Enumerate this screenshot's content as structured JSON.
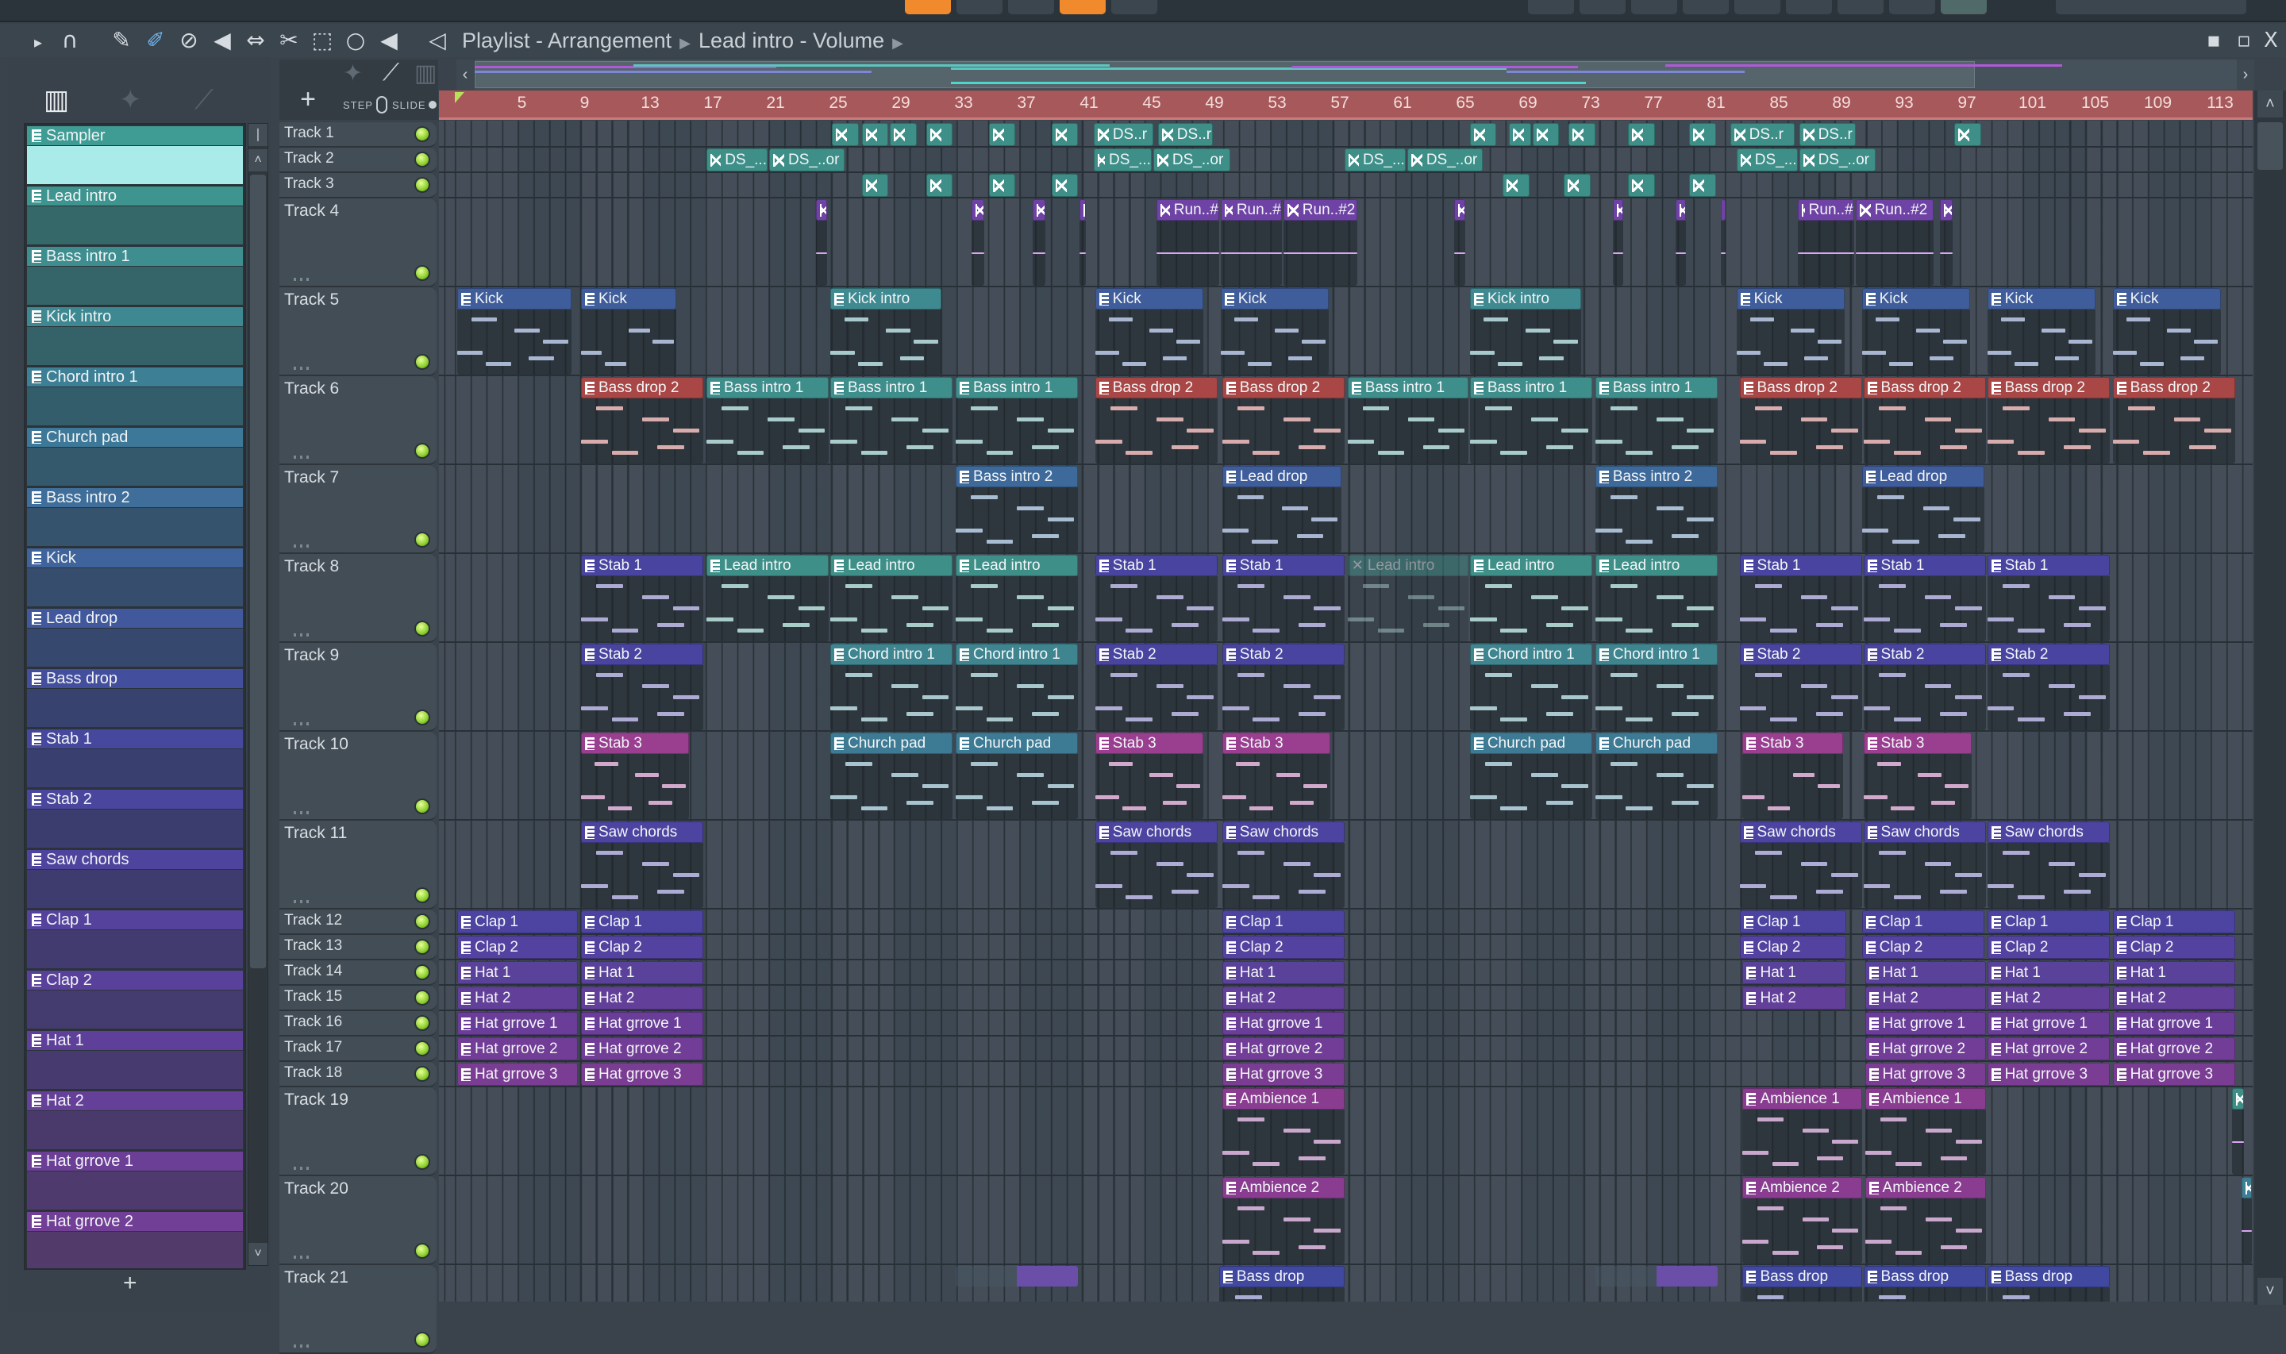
{
  "window": {
    "title": "Playlist - Arrangement",
    "subtitle": "Lead intro - Volume",
    "minimize": "▪",
    "maximize": "▫",
    "close": "X"
  },
  "toolbar_icons": [
    "play-arrow",
    "magnet-snap",
    "draw-pencil",
    "paint-brush",
    "delete",
    "mute",
    "slip",
    "slice",
    "select",
    "zoom",
    "playback",
    "speaker"
  ],
  "header": {
    "add": "+",
    "step": "STEP",
    "slide": "SLIDE"
  },
  "ruler": {
    "bars": [
      5,
      9,
      13,
      17,
      21,
      25,
      29,
      33,
      37,
      41,
      45,
      49,
      53,
      57,
      61,
      65,
      69,
      73,
      77,
      81,
      85,
      89,
      93,
      97,
      101,
      105,
      109,
      113
    ]
  },
  "picker": {
    "selected": "Sampler",
    "add": "+",
    "items": [
      {
        "label": "Sampler",
        "color": "#3f9c94"
      },
      {
        "label": "Lead intro",
        "color": "#3e948f"
      },
      {
        "label": "Bass intro 1",
        "color": "#3e8e90"
      },
      {
        "label": "Kick intro",
        "color": "#3e8892"
      },
      {
        "label": "Chord intro 1",
        "color": "#3d8095"
      },
      {
        "label": "Church pad",
        "color": "#3d7898"
      },
      {
        "label": "Bass intro 2",
        "color": "#3e6e99"
      },
      {
        "label": "Kick",
        "color": "#3f639b"
      },
      {
        "label": "Lead drop",
        "color": "#41599c"
      },
      {
        "label": "Bass drop",
        "color": "#434e9d"
      },
      {
        "label": "Stab 1",
        "color": "#46489d"
      },
      {
        "label": "Stab 2",
        "color": "#4a469d"
      },
      {
        "label": "Saw chords",
        "color": "#4e449d"
      },
      {
        "label": "Clap 1",
        "color": "#54429c"
      },
      {
        "label": "Clap 2",
        "color": "#59419b"
      },
      {
        "label": "Hat 1",
        "color": "#5e409a"
      },
      {
        "label": "Hat 2",
        "color": "#654098"
      },
      {
        "label": "Hat grrove 1",
        "color": "#6c3f97"
      },
      {
        "label": "Hat grrove 2",
        "color": "#723f96"
      }
    ]
  },
  "tracks": [
    "Track 1",
    "Track 2",
    "Track 3",
    "Track 4",
    "Track 5",
    "Track 6",
    "Track 7",
    "Track 8",
    "Track 9",
    "Track 10",
    "Track 11",
    "Track 12",
    "Track 13",
    "Track 14",
    "Track 15",
    "Track 16",
    "Track 17",
    "Track 18",
    "Track 19",
    "Track 20",
    "Track 21"
  ],
  "clips": [
    [
      1,
      25,
      1.8,
      "",
      "#3d8f88",
      "audio"
    ],
    [
      1,
      26.9,
      1.8,
      "",
      "#3d8f88",
      "audio"
    ],
    [
      1,
      28.7,
      1.8,
      "",
      "#3d8f88",
      "audio"
    ],
    [
      1,
      31,
      1.8,
      "",
      "#3d8f88",
      "audio"
    ],
    [
      1,
      35,
      1.8,
      "",
      "#3d8f88",
      "audio"
    ],
    [
      1,
      39,
      1.8,
      "",
      "#3d8f88",
      "audio"
    ],
    [
      1,
      41.7,
      3.9,
      "DS..r",
      "#3d8f88",
      "audio"
    ],
    [
      1,
      45.8,
      3.6,
      "DS..r",
      "#3d8f88",
      "audio"
    ],
    [
      1,
      65.7,
      1.8,
      "",
      "#3d8f88",
      "audio"
    ],
    [
      1,
      68.2,
      1.5,
      "",
      "#3d8f88",
      "audio"
    ],
    [
      1,
      69.7,
      1.8,
      "",
      "#3d8f88",
      "audio"
    ],
    [
      1,
      72,
      1.8,
      "",
      "#3d8f88",
      "audio"
    ],
    [
      1,
      75.8,
      1.8,
      "",
      "#3d8f88",
      "audio"
    ],
    [
      1,
      79.7,
      1.8,
      "",
      "#3d8f88",
      "audio"
    ],
    [
      1,
      82.3,
      4.2,
      "DS..r",
      "#3d8f88",
      "audio"
    ],
    [
      1,
      86.7,
      3.7,
      "DS..r",
      "#3d8f88",
      "audio"
    ],
    [
      1,
      96.6,
      1.8,
      "",
      "#3d8f88",
      "audio"
    ],
    [
      2,
      17,
      4,
      "DS_...",
      "#3d8f88",
      "audio"
    ],
    [
      2,
      21,
      4.9,
      "DS_..or",
      "#3d8f88",
      "audio"
    ],
    [
      2,
      41.7,
      3.8,
      "DS_...",
      "#3d8f88",
      "audio"
    ],
    [
      2,
      45.5,
      5,
      "DS_..or",
      "#3d8f88",
      "audio"
    ],
    [
      2,
      57.7,
      4,
      "DS_...",
      "#3d8f88",
      "audio"
    ],
    [
      2,
      61.7,
      4.9,
      "DS_..or",
      "#3d8f88",
      "audio"
    ],
    [
      2,
      82.7,
      4,
      "DS_...",
      "#3d8f88",
      "audio"
    ],
    [
      2,
      86.7,
      5,
      "DS_..or",
      "#3d8f88",
      "audio"
    ],
    [
      3,
      26.9,
      1.8,
      "",
      "#3d8f88",
      "audio"
    ],
    [
      3,
      31,
      1.8,
      "",
      "#3d8f88",
      "audio"
    ],
    [
      3,
      35,
      1.8,
      "",
      "#3d8f88",
      "audio"
    ],
    [
      3,
      39,
      1.8,
      "",
      "#3d8f88",
      "audio"
    ],
    [
      3,
      67.8,
      1.8,
      "",
      "#3d8f88",
      "audio"
    ],
    [
      3,
      71.7,
      1.8,
      "",
      "#3d8f88",
      "audio"
    ],
    [
      3,
      75.8,
      1.8,
      "",
      "#3d8f88",
      "audio"
    ],
    [
      3,
      79.7,
      1.8,
      "",
      "#3d8f88",
      "audio"
    ],
    [
      4,
      24,
      0.8,
      "",
      "#6f43a6",
      "audio"
    ],
    [
      4,
      33.9,
      0.9,
      "",
      "#6f43a6",
      "audio"
    ],
    [
      4,
      37.8,
      0.9,
      "",
      "#6f43a6",
      "audio"
    ],
    [
      4,
      40.8,
      0.5,
      "",
      "#6f43a6",
      "audio"
    ],
    [
      4,
      45.7,
      4.1,
      "Run..#",
      "#6f43a6",
      "audio"
    ],
    [
      4,
      49.8,
      4,
      "Run..#",
      "#6f43a6",
      "audio"
    ],
    [
      4,
      53.8,
      4.8,
      "Run..#2",
      "#6f43a6",
      "audio"
    ],
    [
      4,
      64.7,
      0.8,
      "",
      "#6f43a6",
      "audio"
    ],
    [
      4,
      74.8,
      0.8,
      "",
      "#6f43a6",
      "audio"
    ],
    [
      4,
      78.8,
      0.8,
      "",
      "#6f43a6",
      "audio"
    ],
    [
      4,
      81.7,
      0.4,
      "",
      "#6f43a6",
      "audio"
    ],
    [
      4,
      86.6,
      3.7,
      "Run..#",
      "#6f43a6",
      "audio"
    ],
    [
      4,
      90.3,
      5.1,
      "Run..#2",
      "#6f43a6",
      "audio"
    ],
    [
      4,
      95.7,
      0.9,
      "",
      "#6f43a6",
      "audio"
    ],
    [
      5,
      1.1,
      7.4,
      "Kick",
      "#3f5d9a"
    ],
    [
      5,
      9,
      6.2,
      "Kick",
      "#3f5d9a"
    ],
    [
      5,
      24.9,
      7.2,
      "Kick intro",
      "#3e8a90"
    ],
    [
      5,
      41.8,
      7,
      "Kick",
      "#3f5d9a"
    ],
    [
      5,
      49.8,
      7,
      "Kick",
      "#3f5d9a"
    ],
    [
      5,
      65.7,
      7.2,
      "Kick intro",
      "#3e8a90"
    ],
    [
      5,
      82.7,
      7,
      "Kick",
      "#3f5d9a"
    ],
    [
      5,
      90.7,
      7,
      "Kick",
      "#3f5d9a"
    ],
    [
      5,
      98.7,
      7,
      "Kick",
      "#3f5d9a"
    ],
    [
      5,
      106.7,
      7,
      "Kick",
      "#3f5d9a"
    ],
    [
      6,
      9,
      7.9,
      "Bass drop 2",
      "#a94646"
    ],
    [
      6,
      17,
      7.9,
      "Bass intro 1",
      "#3e8e8c"
    ],
    [
      6,
      24.9,
      7.9,
      "Bass intro 1",
      "#3e8e8c"
    ],
    [
      6,
      32.9,
      7.9,
      "Bass intro 1",
      "#3e8e8c"
    ],
    [
      6,
      41.8,
      7.9,
      "Bass drop 2",
      "#a94646"
    ],
    [
      6,
      49.9,
      7.9,
      "Bass drop 2",
      "#a94646"
    ],
    [
      6,
      57.9,
      7.8,
      "Bass intro 1",
      "#3e8e8c"
    ],
    [
      6,
      65.7,
      7.9,
      "Bass intro 1",
      "#3e8e8c"
    ],
    [
      6,
      73.7,
      7.9,
      "Bass intro 1",
      "#3e8e8c"
    ],
    [
      6,
      82.9,
      7.9,
      "Bass drop 2",
      "#a94646"
    ],
    [
      6,
      90.8,
      7.9,
      "Bass drop 2",
      "#a94646"
    ],
    [
      6,
      98.7,
      7.9,
      "Bass drop 2",
      "#a94646"
    ],
    [
      6,
      106.7,
      7.9,
      "Bass drop 2",
      "#a94646"
    ],
    [
      7,
      32.9,
      7.9,
      "Bass intro 2",
      "#3d6a9a"
    ],
    [
      7,
      49.9,
      7.7,
      "Lead drop",
      "#3f5c9b"
    ],
    [
      7,
      73.7,
      7.9,
      "Bass intro 2",
      "#3d6a9a"
    ],
    [
      7,
      90.7,
      7.9,
      "Lead drop",
      "#3f5c9b"
    ],
    [
      8,
      9,
      7.9,
      "Stab 1",
      "#4844a0"
    ],
    [
      8,
      17,
      7.9,
      "Lead intro",
      "#3d8f88"
    ],
    [
      8,
      24.9,
      7.9,
      "Lead intro",
      "#3d8f88"
    ],
    [
      8,
      32.9,
      7.9,
      "Lead intro",
      "#3d8f88"
    ],
    [
      8,
      41.8,
      7.9,
      "Stab 1",
      "#4844a0"
    ],
    [
      8,
      49.9,
      7.9,
      "Stab 1",
      "#4844a0"
    ],
    [
      8,
      57.9,
      7.8,
      "Lead intro",
      "#3d8f88",
      "muted"
    ],
    [
      8,
      65.7,
      7.9,
      "Lead intro",
      "#3d8f88"
    ],
    [
      8,
      73.7,
      7.9,
      "Lead intro",
      "#3d8f88"
    ],
    [
      8,
      82.9,
      7.9,
      "Stab 1",
      "#4844a0"
    ],
    [
      8,
      90.8,
      7.9,
      "Stab 1",
      "#4844a0"
    ],
    [
      8,
      98.7,
      7.9,
      "Stab 1",
      "#4844a0"
    ],
    [
      9,
      9,
      7.9,
      "Stab 2",
      "#4944a0"
    ],
    [
      9,
      24.9,
      7.9,
      "Chord intro 1",
      "#3e8590"
    ],
    [
      9,
      32.9,
      7.9,
      "Chord intro 1",
      "#3e8590"
    ],
    [
      9,
      41.8,
      7.9,
      "Stab 2",
      "#4944a0"
    ],
    [
      9,
      49.9,
      7.9,
      "Stab 2",
      "#4944a0"
    ],
    [
      9,
      65.7,
      7.9,
      "Chord intro 1",
      "#3e8590"
    ],
    [
      9,
      73.7,
      7.9,
      "Chord intro 1",
      "#3e8590"
    ],
    [
      9,
      82.9,
      7.9,
      "Stab 2",
      "#4944a0"
    ],
    [
      9,
      90.8,
      7.9,
      "Stab 2",
      "#4944a0"
    ],
    [
      9,
      98.7,
      7.9,
      "Stab 2",
      "#4944a0"
    ],
    [
      10,
      9,
      7,
      "Stab 3",
      "#9a3f90"
    ],
    [
      10,
      24.9,
      7.9,
      "Church pad",
      "#3d7b95"
    ],
    [
      10,
      32.9,
      7.9,
      "Church pad",
      "#3d7b95"
    ],
    [
      10,
      41.8,
      7,
      "Stab 3",
      "#9a3f90"
    ],
    [
      10,
      49.9,
      7,
      "Stab 3",
      "#9a3f90"
    ],
    [
      10,
      65.7,
      7.9,
      "Church pad",
      "#3d7b95"
    ],
    [
      10,
      73.7,
      7.9,
      "Church pad",
      "#3d7b95"
    ],
    [
      10,
      83.1,
      6.5,
      "Stab 3",
      "#9a3f90"
    ],
    [
      10,
      90.8,
      7,
      "Stab 3",
      "#9a3f90"
    ],
    [
      11,
      9,
      7.9,
      "Saw chords",
      "#4c44a0"
    ],
    [
      11,
      41.8,
      7.9,
      "Saw chords",
      "#4c44a0"
    ],
    [
      11,
      49.9,
      7.9,
      "Saw chords",
      "#4c44a0"
    ],
    [
      11,
      82.9,
      7.9,
      "Saw chords",
      "#4c44a0"
    ],
    [
      11,
      90.8,
      7.9,
      "Saw chords",
      "#4c44a0"
    ],
    [
      11,
      98.7,
      7.9,
      "Saw chords",
      "#4c44a0"
    ],
    [
      12,
      1.1,
      7.8,
      "Clap 1",
      "#4c44a0"
    ],
    [
      12,
      9,
      7.9,
      "Clap 1",
      "#4c44a0"
    ],
    [
      12,
      49.9,
      7.9,
      "Clap 1",
      "#4c44a0"
    ],
    [
      12,
      82.9,
      6.9,
      "Clap 1",
      "#4c44a0"
    ],
    [
      12,
      90.7,
      7.9,
      "Clap 1",
      "#4c44a0"
    ],
    [
      12,
      98.7,
      7.9,
      "Clap 1",
      "#4c44a0"
    ],
    [
      12,
      106.7,
      7.9,
      "Clap 1",
      "#4c44a0"
    ],
    [
      13,
      1.1,
      7.8,
      "Clap 2",
      "#5442a0"
    ],
    [
      13,
      9,
      7.9,
      "Clap 2",
      "#5442a0"
    ],
    [
      13,
      49.9,
      7.9,
      "Clap 2",
      "#5442a0"
    ],
    [
      13,
      82.9,
      6.9,
      "Clap 2",
      "#5442a0"
    ],
    [
      13,
      90.7,
      7.9,
      "Clap 2",
      "#5442a0"
    ],
    [
      13,
      98.7,
      7.9,
      "Clap 2",
      "#5442a0"
    ],
    [
      13,
      106.7,
      7.9,
      "Clap 2",
      "#5442a0"
    ],
    [
      14,
      1.1,
      7.8,
      "Hat 1",
      "#5a419a"
    ],
    [
      14,
      9,
      7.9,
      "Hat 1",
      "#5a419a"
    ],
    [
      14,
      49.9,
      7.9,
      "Hat 1",
      "#5a419a"
    ],
    [
      14,
      83.1,
      6.7,
      "Hat 1",
      "#5a419a"
    ],
    [
      14,
      90.9,
      7.8,
      "Hat 1",
      "#5a419a"
    ],
    [
      14,
      98.7,
      7.9,
      "Hat 1",
      "#5a419a"
    ],
    [
      14,
      106.7,
      7.9,
      "Hat 1",
      "#5a419a"
    ],
    [
      15,
      1.1,
      7.8,
      "Hat 2",
      "#623f98"
    ],
    [
      15,
      9,
      7.9,
      "Hat 2",
      "#623f98"
    ],
    [
      15,
      49.9,
      7.9,
      "Hat 2",
      "#623f98"
    ],
    [
      15,
      83.1,
      6.7,
      "Hat 2",
      "#623f98"
    ],
    [
      15,
      90.9,
      7.8,
      "Hat 2",
      "#623f98"
    ],
    [
      15,
      98.7,
      7.9,
      "Hat 2",
      "#623f98"
    ],
    [
      15,
      106.7,
      7.9,
      "Hat 2",
      "#623f98"
    ],
    [
      16,
      1.1,
      7.8,
      "Hat grrove 1",
      "#6a3e98"
    ],
    [
      16,
      9,
      7.9,
      "Hat grrove 1",
      "#6a3e98"
    ],
    [
      16,
      49.9,
      7.9,
      "Hat grrove 1",
      "#6a3e98"
    ],
    [
      16,
      90.9,
      7.8,
      "Hat grrove 1",
      "#6a3e98"
    ],
    [
      16,
      98.7,
      7.9,
      "Hat grrove 1",
      "#6a3e98"
    ],
    [
      16,
      106.7,
      7.9,
      "Hat grrove 1",
      "#6a3e98"
    ],
    [
      17,
      1.1,
      7.8,
      "Hat grrove 2",
      "#713d96"
    ],
    [
      17,
      9,
      7.9,
      "Hat grrove 2",
      "#713d96"
    ],
    [
      17,
      49.9,
      7.9,
      "Hat grrove 2",
      "#713d96"
    ],
    [
      17,
      90.9,
      7.8,
      "Hat grrove 2",
      "#713d96"
    ],
    [
      17,
      98.7,
      7.9,
      "Hat grrove 2",
      "#713d96"
    ],
    [
      17,
      106.7,
      7.9,
      "Hat grrove 2",
      "#713d96"
    ],
    [
      18,
      1.1,
      7.8,
      "Hat grrove 3",
      "#7b3d94"
    ],
    [
      18,
      9,
      7.9,
      "Hat grrove 3",
      "#7b3d94"
    ],
    [
      18,
      49.9,
      7.9,
      "Hat grrove 3",
      "#7b3d94"
    ],
    [
      18,
      90.9,
      7.8,
      "Hat grrove 3",
      "#7b3d94"
    ],
    [
      18,
      98.7,
      7.9,
      "Hat grrove 3",
      "#7b3d94"
    ],
    [
      18,
      106.7,
      7.9,
      "Hat grrove 3",
      "#7b3d94"
    ],
    [
      19,
      49.9,
      7.9,
      "Ambience 1",
      "#8a3d90"
    ],
    [
      19,
      83.1,
      7.7,
      "Ambience 1",
      "#8a3d90"
    ],
    [
      19,
      90.9,
      7.8,
      "Ambience 1",
      "#8a3d90"
    ],
    [
      19,
      114.3,
      0.9,
      "",
      "#3d8f88",
      "audio"
    ],
    [
      20,
      49.9,
      7.9,
      "Ambience 2",
      "#8a3d90"
    ],
    [
      20,
      83.1,
      7.7,
      "Ambience 2",
      "#8a3d90"
    ],
    [
      20,
      90.9,
      7.8,
      "Ambience 2",
      "#8a3d90"
    ],
    [
      20,
      114.9,
      0.8,
      "",
      "#3d7f95",
      "audio"
    ],
    [
      21,
      32.9,
      7.9,
      "",
      "#6a4ea8",
      "ghost"
    ],
    [
      21,
      49.7,
      8.1,
      "Bass drop",
      "#4048a0"
    ],
    [
      21,
      73.7,
      7.9,
      "",
      "#6a4ea8",
      "ghost"
    ],
    [
      21,
      83.1,
      7.7,
      "Bass drop",
      "#4048a0"
    ],
    [
      21,
      90.8,
      7.9,
      "Bass drop",
      "#4048a0"
    ],
    [
      21,
      98.7,
      7.9,
      "Bass drop",
      "#4048a0"
    ]
  ]
}
